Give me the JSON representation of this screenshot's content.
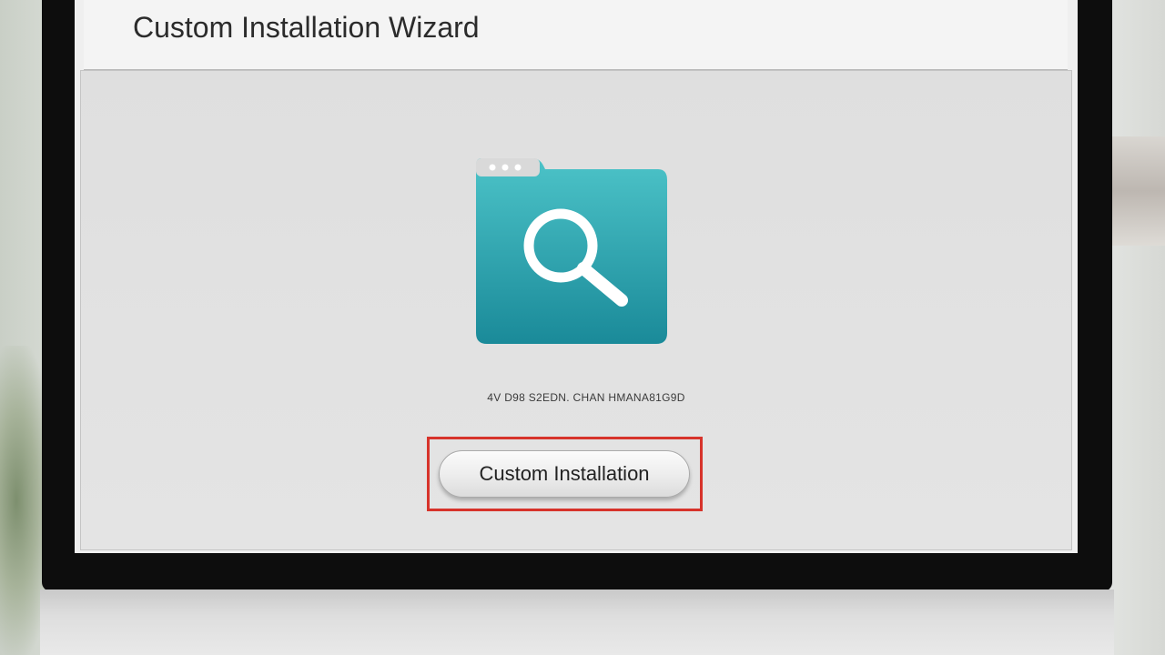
{
  "window": {
    "title": "Custom Installation Wizard"
  },
  "main": {
    "icon": "folder-search-icon",
    "status_text": "4V D98 S2EDN. CHAN HMANA81G9D",
    "install_button_label": "Custom Installation"
  },
  "colors": {
    "icon_teal_top": "#4cc3c8",
    "icon_teal_bottom": "#1a8a99",
    "highlight_red": "#d7332b"
  }
}
